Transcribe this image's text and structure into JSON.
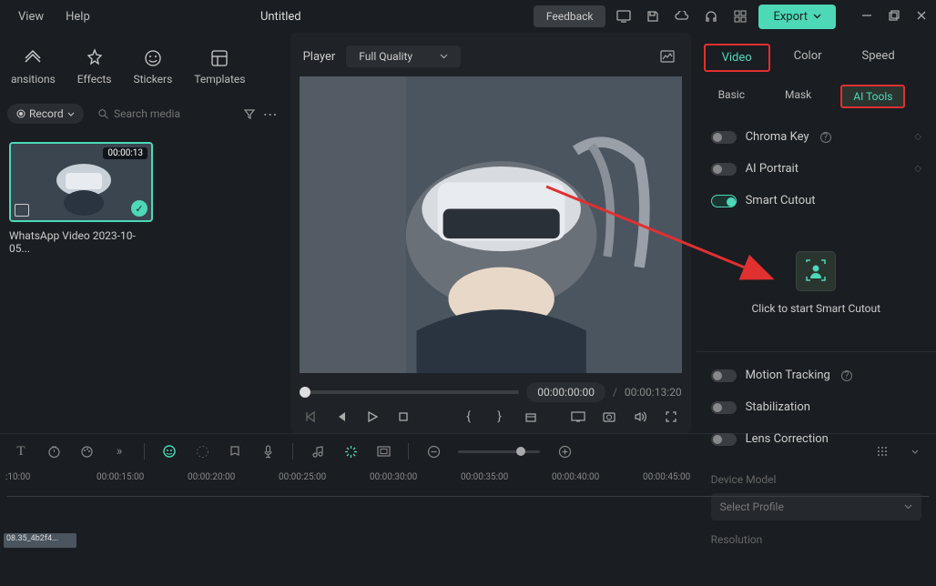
{
  "menu": {
    "view": "View",
    "help": "Help"
  },
  "title": "Untitled",
  "top": {
    "feedback": "Feedback",
    "export": "Export"
  },
  "toolTabs": {
    "transitions": "ansitions",
    "effects": "Effects",
    "stickers": "Stickers",
    "templates": "Templates"
  },
  "media": {
    "record": "Record",
    "searchPlaceholder": "Search media"
  },
  "clip": {
    "duration": "00:00:13",
    "name": "WhatsApp Video 2023-10-05..."
  },
  "player": {
    "label": "Player",
    "quality": "Full Quality",
    "currentTime": "00:00:00:00",
    "totalTime": "00:00:13:20"
  },
  "rightTabs": {
    "video": "Video",
    "color": "Color",
    "speed": "Speed"
  },
  "rightSubtabs": {
    "basic": "Basic",
    "mask": "Mask",
    "ai": "AI Tools"
  },
  "toggles": {
    "chromaKey": "Chroma Key",
    "aiPortrait": "AI Portrait",
    "smartCutout": "Smart Cutout",
    "motionTracking": "Motion Tracking",
    "stabilization": "Stabilization",
    "lensCorrection": "Lens Correction"
  },
  "smartCutoutLabel": "Click to start Smart Cutout",
  "device": {
    "label": "Device Model",
    "placeholder": "Select Profile",
    "resolution": "Resolution"
  },
  "timeline": {
    "marks": [
      ":10:00",
      "00:00:15:00",
      "00:00:20:00",
      "00:00:25:00",
      "00:00:30:00",
      "00:00:35:00",
      "00:00:40:00",
      "00:00:45:00"
    ],
    "clipName": "08.35_4b2f4..."
  }
}
